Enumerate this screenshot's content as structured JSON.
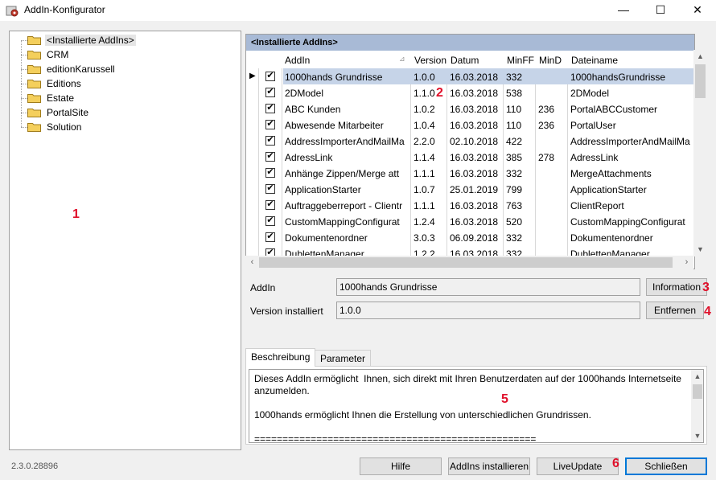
{
  "window": {
    "title": "AddIn-Konfigurator",
    "minimize_glyph": "—",
    "maximize_glyph": "☐",
    "close_glyph": "✕"
  },
  "tree": {
    "items": [
      {
        "label": "<Installierte AddIns>",
        "selected": true
      },
      {
        "label": "CRM"
      },
      {
        "label": "editionKarussell"
      },
      {
        "label": "Editions"
      },
      {
        "label": "Estate"
      },
      {
        "label": "PortalSite"
      },
      {
        "label": "Solution"
      }
    ]
  },
  "annotations": [
    "1",
    "2",
    "3",
    "4",
    "5",
    "6"
  ],
  "grid": {
    "header": "<Installierte AddIns>",
    "columns": [
      "AddIn",
      "Version",
      "Datum",
      "MinFF",
      "MinD",
      "Dateiname"
    ],
    "sort_glyph": "⊿",
    "row_indicator": "▶",
    "check_glyph": "✔",
    "rows": [
      {
        "addin": "1000hands Grundrisse",
        "version": "1.0.0",
        "datum": "16.03.2018",
        "minff": "332",
        "mind": "",
        "dateiname": "1000handsGrundrisse",
        "selected": true
      },
      {
        "addin": "2DModel",
        "version": "1.1.0",
        "datum": "16.03.2018",
        "minff": "538",
        "mind": "",
        "dateiname": "2DModel"
      },
      {
        "addin": "ABC Kunden",
        "version": "1.0.2",
        "datum": "16.03.2018",
        "minff": "110",
        "mind": "236",
        "dateiname": "PortalABCCustomer"
      },
      {
        "addin": "Abwesende Mitarbeiter",
        "version": "1.0.4",
        "datum": "16.03.2018",
        "minff": "110",
        "mind": "236",
        "dateiname": "PortalUser"
      },
      {
        "addin": "AddressImporterAndMailMa",
        "version": "2.2.0",
        "datum": "02.10.2018",
        "minff": "422",
        "mind": "",
        "dateiname": "AddressImporterAndMailMa"
      },
      {
        "addin": "AdressLink",
        "version": "1.1.4",
        "datum": "16.03.2018",
        "minff": "385",
        "mind": "278",
        "dateiname": "AdressLink"
      },
      {
        "addin": "Anhänge Zippen/Merge att",
        "version": "1.1.1",
        "datum": "16.03.2018",
        "minff": "332",
        "mind": "",
        "dateiname": "MergeAttachments"
      },
      {
        "addin": "ApplicationStarter",
        "version": "1.0.7",
        "datum": "25.01.2019",
        "minff": "799",
        "mind": "",
        "dateiname": "ApplicationStarter"
      },
      {
        "addin": "Auftraggeberreport - Clientr",
        "version": "1.1.1",
        "datum": "16.03.2018",
        "minff": "763",
        "mind": "",
        "dateiname": "ClientReport"
      },
      {
        "addin": "CustomMappingConfigurat",
        "version": "1.2.4",
        "datum": "16.03.2018",
        "minff": "520",
        "mind": "",
        "dateiname": "CustomMappingConfigurat"
      },
      {
        "addin": "Dokumentenordner",
        "version": "3.0.3",
        "datum": "06.09.2018",
        "minff": "332",
        "mind": "",
        "dateiname": "Dokumentenordner"
      },
      {
        "addin": "DublettenManager",
        "version": "1.2.2",
        "datum": "16.03.2018",
        "minff": "332",
        "mind": "",
        "dateiname": "DublettenManager"
      }
    ]
  },
  "details": {
    "addin_label": "AddIn",
    "addin_value": "1000hands Grundrisse",
    "version_label": "Version installiert",
    "version_value": "1.0.0",
    "info_button": "Information",
    "remove_button": "Entfernen"
  },
  "tabs": [
    {
      "label": "Beschreibung",
      "active": true
    },
    {
      "label": "Parameter"
    }
  ],
  "description": "Dieses AddIn ermöglicht  Ihnen, sich direkt mit Ihren Benutzerdaten auf der 1000hands Internetseite anzumelden.\n\n1000hands ermöglicht Ihnen die Erstellung von unterschiedlichen Grundrissen.\n\n==================================================",
  "footer": {
    "version": "2.3.0.28896",
    "help_button": "Hilfe",
    "install_button": "AddIns installieren",
    "liveupdate_button": "LiveUpdate",
    "close_button": "Schließen"
  },
  "colors": {
    "header_bg": "#a8bad6",
    "selection_bg": "#c6d4e8",
    "annotation_red": "#e0102a",
    "folder_yellow": "#f4cf5c"
  }
}
